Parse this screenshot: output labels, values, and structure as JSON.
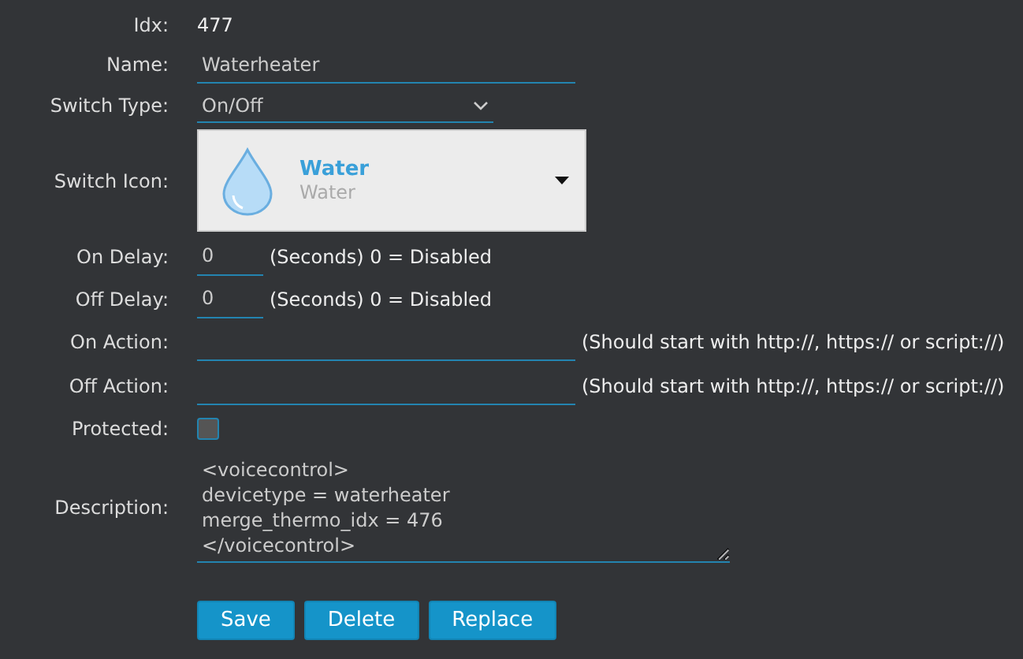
{
  "fields": [
    {
      "kind": "static",
      "label": "Idx:",
      "value": "477"
    },
    {
      "kind": "text",
      "label": "Name:",
      "value": "Waterheater"
    },
    {
      "kind": "select",
      "label": "Switch Type:",
      "value": "On/Off"
    },
    {
      "kind": "icon_picker",
      "label": "Switch Icon:",
      "title": "Water",
      "subtitle": "Water"
    },
    {
      "kind": "short",
      "label": "On Delay:",
      "value": "0",
      "hint": "(Seconds) 0 = Disabled"
    },
    {
      "kind": "short",
      "label": "Off Delay:",
      "value": "0",
      "hint": "(Seconds) 0 = Disabled"
    },
    {
      "kind": "long",
      "label": "On Action:",
      "hint": "(Should start with http://, https:// or script://)"
    },
    {
      "kind": "long",
      "label": "Off Action:",
      "hint": "(Should start with http://, https:// or script://)"
    },
    {
      "kind": "checkbox",
      "label": "Protected:",
      "checked": false
    },
    {
      "kind": "textarea",
      "label": "Description:",
      "value": "<voicecontrol>\ndevicetype = waterheater\nmerge_thermo_idx = 476\n</voicecontrol>"
    }
  ],
  "buttons": [
    "Save",
    "Delete",
    "Replace"
  ]
}
